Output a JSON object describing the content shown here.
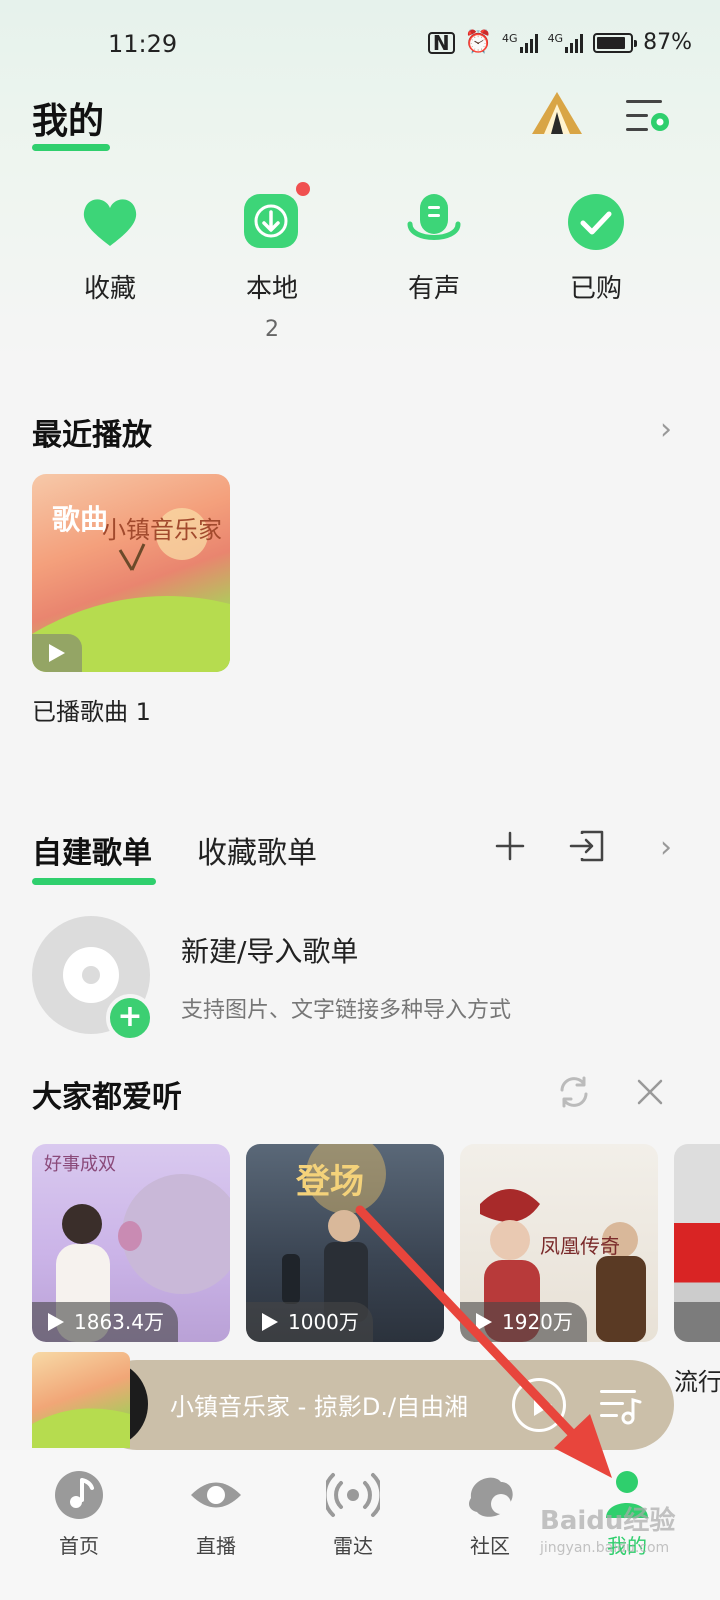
{
  "status": {
    "time": "11:29",
    "battery": "87%",
    "net1": "4G",
    "net2": "4G"
  },
  "header": {
    "title": "我的"
  },
  "quick_access": [
    {
      "label": "收藏",
      "count": "",
      "icon": "heart-icon"
    },
    {
      "label": "本地",
      "count": "2",
      "icon": "download-icon"
    },
    {
      "label": "有声",
      "count": "",
      "icon": "microphone-icon"
    },
    {
      "label": "已购",
      "count": "",
      "icon": "check-icon"
    }
  ],
  "recent": {
    "title": "最近播放",
    "card_tag": "歌曲",
    "card_cover_title": "小镇音乐家",
    "card_label": "已播歌曲 1"
  },
  "playlists": {
    "tab_active": "自建歌单",
    "tab_inactive": "收藏歌单",
    "new_title": "新建/导入歌单",
    "new_subtitle": "支持图片、文字链接多种导入方式"
  },
  "popular": {
    "title": "大家都爱听",
    "cards": [
      {
        "plays": "1863.4万",
        "title": "好事成双",
        "color": "#d9c9ef"
      },
      {
        "plays": "1000万",
        "title": "登场",
        "color": "#4a5564"
      },
      {
        "plays": "1920万",
        "title": "凤凰传奇",
        "color": "#ede8df"
      }
    ],
    "partial_label": "流行"
  },
  "player": {
    "now_playing": "小镇音乐家 - 掠影D./自由湘"
  },
  "tabbar": {
    "items": [
      {
        "label": "首页",
        "icon": "music-note-icon"
      },
      {
        "label": "直播",
        "icon": "eye-icon"
      },
      {
        "label": "雷达",
        "icon": "radar-icon"
      },
      {
        "label": "社区",
        "icon": "community-icon"
      },
      {
        "label": "我的",
        "icon": "user-icon"
      }
    ],
    "active_index": 4
  },
  "colors": {
    "accent": "#2fcf6d",
    "arrow": "#e8453c"
  },
  "watermark": {
    "brand": "Baidu经验",
    "sub": "jingyan.baidu.com"
  }
}
